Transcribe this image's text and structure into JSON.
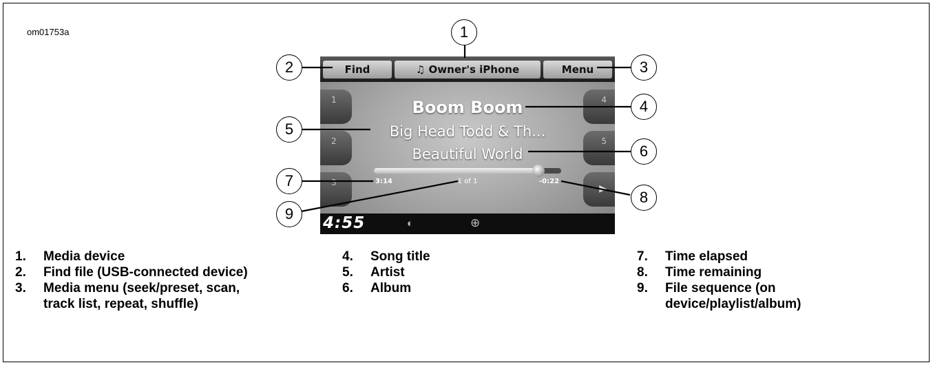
{
  "figure_id": "om01753a",
  "screen": {
    "topbar": {
      "find": "Find",
      "source": "♫ Owner's iPhone",
      "menu": "Menu"
    },
    "presets_left": [
      "1",
      "2",
      "3"
    ],
    "presets_right": [
      "4",
      "5",
      "▶"
    ],
    "song_title": "Boom Boom",
    "artist": "Big Head Todd & Th...",
    "album": "Beautiful World",
    "progress_fraction": 0.88,
    "time_elapsed": "3:14",
    "file_sequence": "1 of 1",
    "time_remaining": "-0:22",
    "clock": "4:55",
    "status_icon1": "bluetooth-icon",
    "status_icon2": "harley-logo-icon"
  },
  "callouts": [
    "1",
    "2",
    "3",
    "4",
    "5",
    "6",
    "7",
    "8",
    "9"
  ],
  "legend": [
    {
      "num": "1.",
      "text": "Media device"
    },
    {
      "num": "2.",
      "text": "Find file (USB-connected device)"
    },
    {
      "num": "3.",
      "text": "Media menu (seek/preset, scan, track list, repeat, shuffle)"
    },
    {
      "num": "4.",
      "text": "Song title"
    },
    {
      "num": "5.",
      "text": "Artist"
    },
    {
      "num": "6.",
      "text": "Album"
    },
    {
      "num": "7.",
      "text": "Time elapsed"
    },
    {
      "num": "8.",
      "text": "Time remaining"
    },
    {
      "num": "9.",
      "text": "File sequence (on device/playlist/album)"
    }
  ]
}
